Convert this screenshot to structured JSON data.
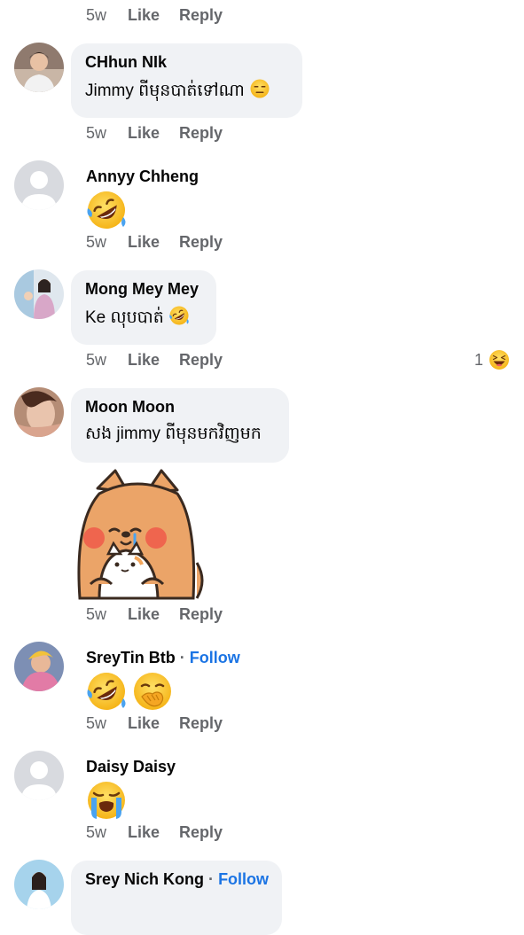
{
  "actions": {
    "like": "Like",
    "reply": "Reply"
  },
  "comments": [
    {
      "author": "",
      "text": "",
      "time": "5w"
    },
    {
      "author": "CHhun NIk",
      "text": "Jimmy ពីមុនបាត់ទៅណា",
      "time": "5w"
    },
    {
      "author": "Annyy Chheng",
      "text": "",
      "time": "5w"
    },
    {
      "author": "Mong Mey Mey",
      "text": "Ke លុបបាត់",
      "time": "5w",
      "reaction_count": "1"
    },
    {
      "author": "Moon Moon",
      "text": "សង jimmy ពីមុនមកវិញមក",
      "time": "5w"
    },
    {
      "author": "SreyTin Btb",
      "follow": "Follow",
      "separator": "·",
      "text": "",
      "time": "5w"
    },
    {
      "author": "Daisy Daisy",
      "text": "",
      "time": "5w"
    },
    {
      "author": "Srey Nich Kong",
      "follow": "Follow",
      "separator": "·",
      "text": "",
      "time": ""
    }
  ],
  "icons": {
    "emoji_expressionless": "expressionless-face-icon",
    "emoji_rofl": "rolling-on-floor-laughing-icon",
    "emoji_hand_over_mouth": "face-with-hand-over-mouth-icon",
    "emoji_crying": "loudly-crying-face-icon",
    "reaction_haha": "haha-reaction-icon",
    "sticker": "shiba-dog-hugging-cat-sticker"
  },
  "colors": {
    "bubble": "#f0f2f5",
    "meta": "#65676b",
    "follow": "#1b74e4"
  }
}
